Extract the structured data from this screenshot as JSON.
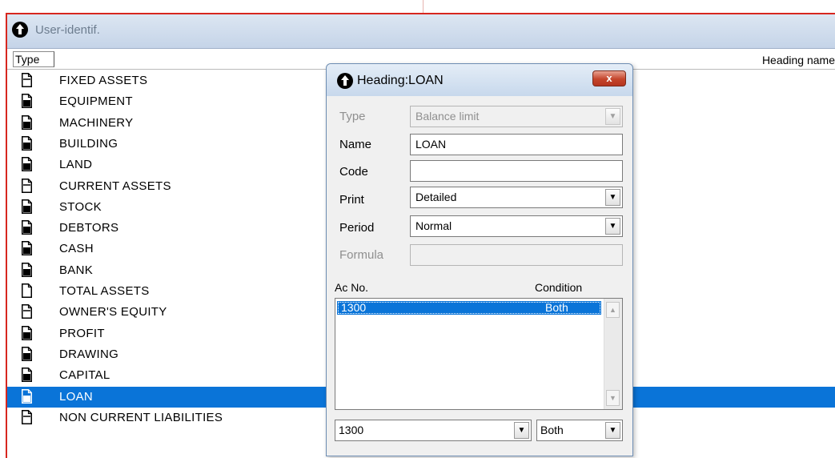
{
  "window": {
    "title": "User-identif."
  },
  "columns": {
    "type": "Type",
    "heading_name": "Heading name"
  },
  "rows": [
    {
      "label": "FIXED ASSETS",
      "icon": "heading-page-icon"
    },
    {
      "label": "EQUIPMENT",
      "icon": "account-page-icon"
    },
    {
      "label": "MACHINERY",
      "icon": "account-page-icon"
    },
    {
      "label": "BUILDING",
      "icon": "account-page-icon"
    },
    {
      "label": "LAND",
      "icon": "account-page-icon"
    },
    {
      "label": "CURRENT ASSETS",
      "icon": "heading-page-icon"
    },
    {
      "label": "STOCK",
      "icon": "account-page-icon"
    },
    {
      "label": "DEBTORS",
      "icon": "account-page-icon"
    },
    {
      "label": "CASH",
      "icon": "account-page-icon"
    },
    {
      "label": "BANK",
      "icon": "account-page-icon"
    },
    {
      "label": "TOTAL ASSETS",
      "icon": "total-page-icon"
    },
    {
      "label": "OWNER'S EQUITY",
      "icon": "heading-page-icon"
    },
    {
      "label": "PROFIT",
      "icon": "account-page-icon"
    },
    {
      "label": "DRAWING",
      "icon": "account-page-icon"
    },
    {
      "label": "CAPITAL",
      "icon": "account-page-icon"
    },
    {
      "label": "LOAN",
      "icon": "account-page-icon",
      "selected": true
    },
    {
      "label": "NON CURRENT LIABILITIES",
      "icon": "heading-page-icon"
    }
  ],
  "dialog": {
    "title": "Heading:LOAN",
    "close_label": "x",
    "fields": {
      "type": {
        "label": "Type",
        "value": "Balance limit"
      },
      "name": {
        "label": "Name",
        "value": "LOAN"
      },
      "code": {
        "label": "Code",
        "value": ""
      },
      "print": {
        "label": "Print",
        "value": "Detailed"
      },
      "period": {
        "label": "Period",
        "value": "Normal"
      },
      "formula": {
        "label": "Formula",
        "value": ""
      }
    },
    "list_headers": {
      "ac_no": "Ac No.",
      "condition": "Condition"
    },
    "list_rows": [
      {
        "ac_no": "1300",
        "condition": "Both"
      }
    ],
    "bottom": {
      "ac_no": "1300",
      "condition": "Both"
    }
  },
  "colors": {
    "selection": "#0a74d8",
    "frame_border": "#d7271f",
    "close_button": "#c4452b"
  }
}
